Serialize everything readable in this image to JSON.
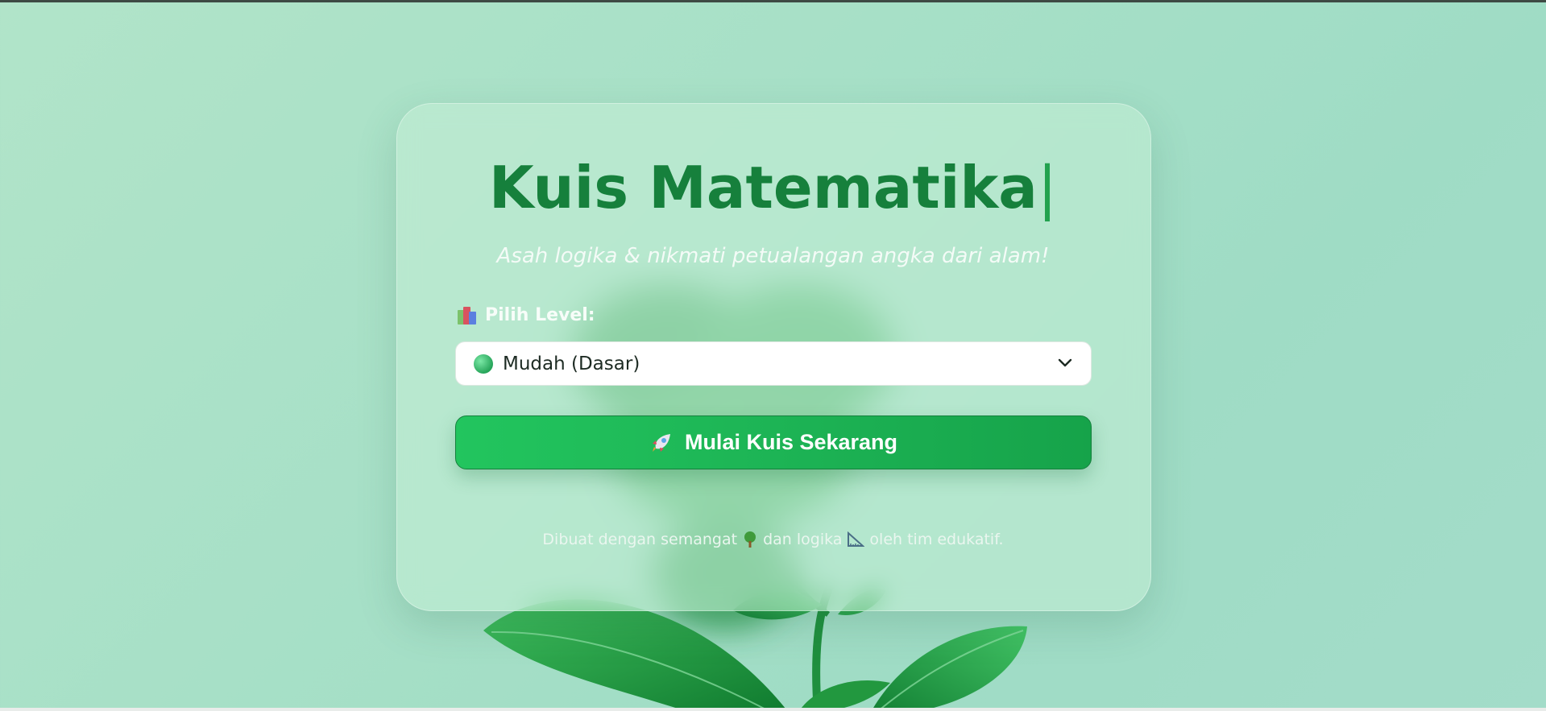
{
  "header": {
    "title": "Kuis Matematika",
    "cursor": "|",
    "subtitle": "Asah logika & nikmati petualangan angka dari alam!"
  },
  "level": {
    "label": "Pilih Level:",
    "icon": "books-icon",
    "selected_value": "Mudah (Dasar)",
    "selected_icon": "green-circle-icon"
  },
  "actions": {
    "start_label": "Mulai Kuis Sekarang",
    "start_icon": "rocket-icon"
  },
  "footer": {
    "part1": "Dibuat dengan semangat",
    "tree_icon": "tree-icon",
    "part2": "dan logika",
    "ruler_icon": "triangle-ruler-icon",
    "part3": "oleh tim edukatif."
  },
  "colors": {
    "title": "#16803c",
    "accent": "#22c55e",
    "background": "#a7e0c7"
  }
}
